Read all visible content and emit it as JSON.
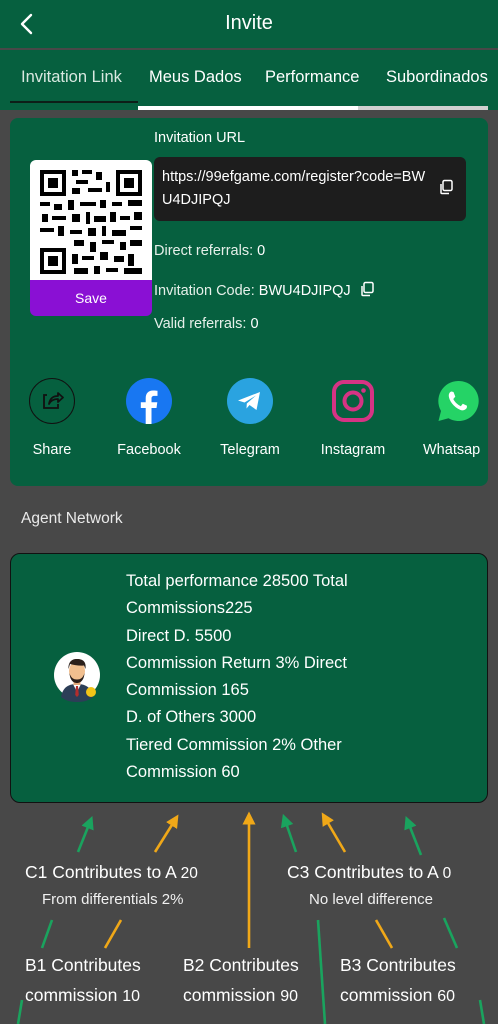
{
  "header": {
    "title": "Invite",
    "back_icon": "chevron-left-icon"
  },
  "tabs": [
    {
      "label": "Invitation Link",
      "active": true
    },
    {
      "label": "Meus Dados"
    },
    {
      "label": "Performance"
    },
    {
      "label": "Subordinados"
    }
  ],
  "invite": {
    "qr_icon": "qr-code",
    "save_label": "Save",
    "url_label": "Invitation URL",
    "url": "https://99efgame.com/register?code=BWU4DJIPQJ",
    "direct_label": "Direct referrals:",
    "direct_value": "0",
    "code_label": "Invitation Code:",
    "code_value": "BWU4DJIPQJ",
    "valid_label": "Valid referrals:",
    "valid_value": "0"
  },
  "share": [
    {
      "label": "Share",
      "icon": "share-icon"
    },
    {
      "label": "Facebook",
      "icon": "facebook-icon",
      "color": "#1877f2"
    },
    {
      "label": "Telegram",
      "icon": "telegram-icon",
      "color": "#2aa3e0"
    },
    {
      "label": "Instagram",
      "icon": "instagram-icon",
      "color": "#d63384"
    },
    {
      "label": "Whatsap",
      "icon": "whatsapp-icon",
      "color": "#25d366"
    }
  ],
  "agent_network": {
    "title": "Agent Network",
    "lines": [
      "Total performance 28500 Total",
      "Commissions225",
      "Direct D. 5500",
      "Commission Return 3% Direct",
      "Commission 165",
      "D. of Others 3000",
      "Tiered Commission 2% Other",
      "Commission 60"
    ]
  },
  "contributions": {
    "c1": "C1 Contributes to A",
    "c1_value": "20",
    "c1_sub": "From differentials 2%",
    "c3": "C3 Contributes to A",
    "c3_value": "0",
    "c3_sub": "No level difference",
    "b1_line1": "B1 Contributes",
    "b1_line2": "commission",
    "b1_value": "10",
    "b2_line1": "B2 Contributes",
    "b2_line2": "commission",
    "b2_value": "90",
    "b3_line1": "B3 Contributes",
    "b3_line2": "commission",
    "b3_value": "60"
  },
  "colors": {
    "brand_green": "#06603f",
    "save_purple": "#8a10d4",
    "arrow_green": "#1aa35e",
    "arrow_orange": "#f0a818"
  }
}
